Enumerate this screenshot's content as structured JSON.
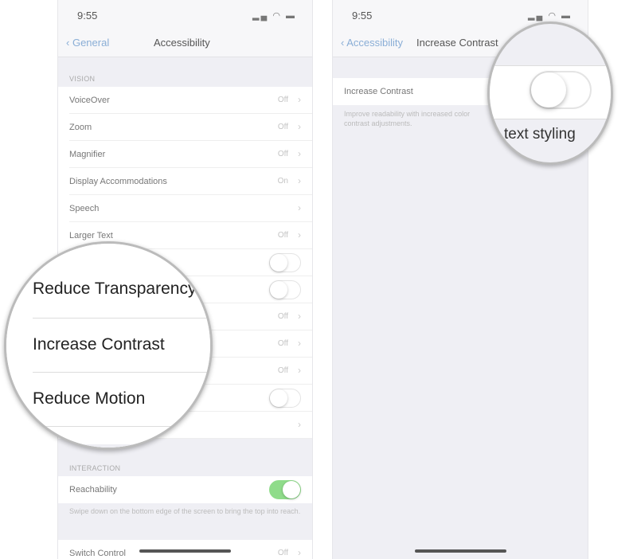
{
  "left": {
    "time": "9:55",
    "back": "General",
    "title": "Accessibility",
    "vision_header": "VISION",
    "rows": [
      {
        "label": "VoiceOver",
        "value": "Off"
      },
      {
        "label": "Zoom",
        "value": "Off"
      },
      {
        "label": "Magnifier",
        "value": "Off"
      },
      {
        "label": "Display Accommodations",
        "value": "On"
      },
      {
        "label": "Speech",
        "value": ""
      },
      {
        "label": "Larger Text",
        "value": "Off"
      }
    ],
    "hidden_values": [
      "Off",
      "Off",
      "Off"
    ],
    "interaction_header": "INTERACTION",
    "reachability": "Reachability",
    "reachability_on": true,
    "reach_footer": "Swipe down on the bottom edge of the screen to bring the top into reach.",
    "switch_control": "Switch Control",
    "switch_value": "Off",
    "magnifier": [
      "Reduce Transparency",
      "Increase Contrast",
      "Reduce Motion"
    ]
  },
  "right": {
    "time": "9:55",
    "back": "Accessibility",
    "title": "Increase Contrast",
    "row": "Increase Contrast",
    "toggle_on": false,
    "footer": "Improve readability with increased color contrast adjustments.",
    "magnifier_text": "text styling"
  },
  "colors": {
    "accent": "#8aaed6",
    "switch_on": "#8fdc8a"
  }
}
